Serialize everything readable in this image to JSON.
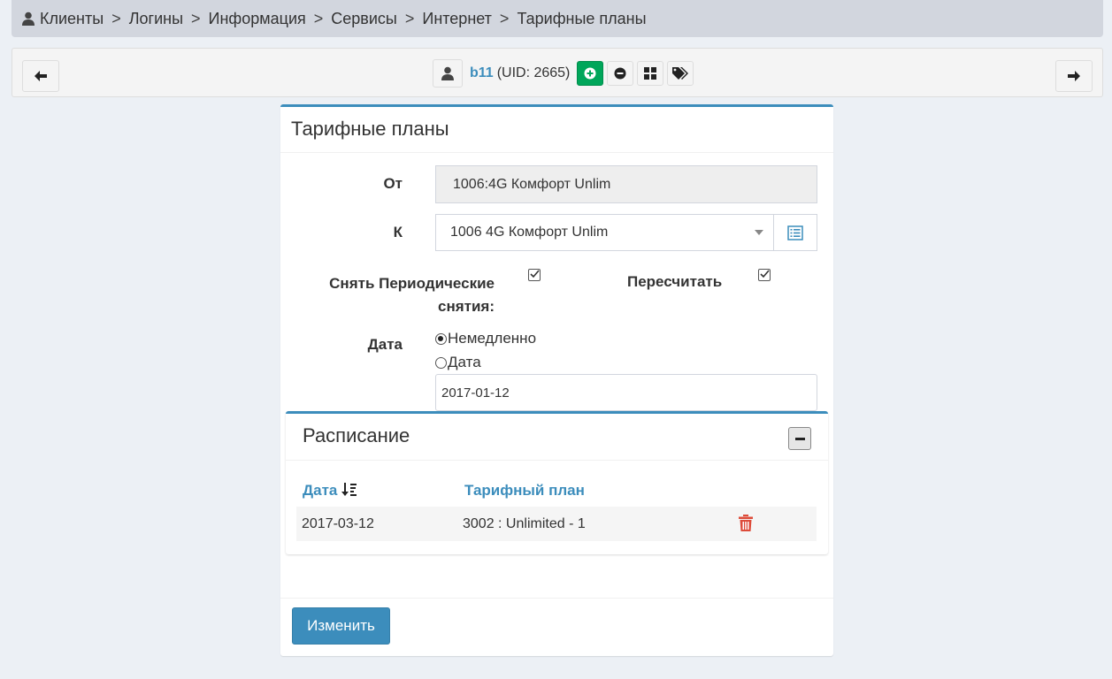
{
  "breadcrumb": {
    "separator": ">",
    "items": [
      "Клиенты",
      "Логины",
      "Информация",
      "Сервисы",
      "Интернет",
      "Тарифные планы"
    ]
  },
  "user_bar": {
    "login": "b11",
    "uid_text": "(UID: 2665)"
  },
  "card": {
    "title": "Тарифные планы",
    "from_label": "От",
    "from_value": "1006:4G Комфорт Unlim",
    "to_label": "К",
    "to_value": "1006 4G Комфорт Unlim",
    "remove_periodic_label_1": "Снять Периодические",
    "remove_periodic_label_2": "снятия:",
    "remove_periodic_checked": true,
    "recalc_label": "Пересчитать",
    "recalc_checked": true,
    "date_label": "Дата",
    "radio_now": "Немедленно",
    "radio_date": "Дата",
    "date_value": "2017-01-12",
    "submit_label": "Изменить"
  },
  "schedule": {
    "title": "Расписание",
    "columns": [
      "Дата",
      "Тарифный план"
    ],
    "rows": [
      {
        "date": "2017-03-12",
        "plan": "3002 : Unlimited - 1"
      }
    ]
  },
  "colors": {
    "accent": "#3c8dbc",
    "success": "#00a65a",
    "danger": "#dd4b39"
  }
}
